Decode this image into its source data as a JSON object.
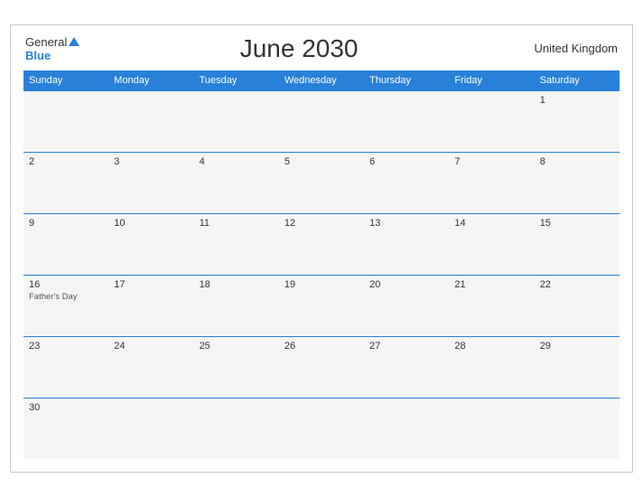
{
  "header": {
    "logo_general": "General",
    "logo_blue": "Blue",
    "title": "June 2030",
    "region": "United Kingdom"
  },
  "weekdays": [
    "Sunday",
    "Monday",
    "Tuesday",
    "Wednesday",
    "Thursday",
    "Friday",
    "Saturday"
  ],
  "weeks": [
    [
      {
        "day": "",
        "event": ""
      },
      {
        "day": "",
        "event": ""
      },
      {
        "day": "",
        "event": ""
      },
      {
        "day": "",
        "event": ""
      },
      {
        "day": "",
        "event": ""
      },
      {
        "day": "",
        "event": ""
      },
      {
        "day": "1",
        "event": ""
      }
    ],
    [
      {
        "day": "2",
        "event": ""
      },
      {
        "day": "3",
        "event": ""
      },
      {
        "day": "4",
        "event": ""
      },
      {
        "day": "5",
        "event": ""
      },
      {
        "day": "6",
        "event": ""
      },
      {
        "day": "7",
        "event": ""
      },
      {
        "day": "8",
        "event": ""
      }
    ],
    [
      {
        "day": "9",
        "event": ""
      },
      {
        "day": "10",
        "event": ""
      },
      {
        "day": "11",
        "event": ""
      },
      {
        "day": "12",
        "event": ""
      },
      {
        "day": "13",
        "event": ""
      },
      {
        "day": "14",
        "event": ""
      },
      {
        "day": "15",
        "event": ""
      }
    ],
    [
      {
        "day": "16",
        "event": "Father's Day"
      },
      {
        "day": "17",
        "event": ""
      },
      {
        "day": "18",
        "event": ""
      },
      {
        "day": "19",
        "event": ""
      },
      {
        "day": "20",
        "event": ""
      },
      {
        "day": "21",
        "event": ""
      },
      {
        "day": "22",
        "event": ""
      }
    ],
    [
      {
        "day": "23",
        "event": ""
      },
      {
        "day": "24",
        "event": ""
      },
      {
        "day": "25",
        "event": ""
      },
      {
        "day": "26",
        "event": ""
      },
      {
        "day": "27",
        "event": ""
      },
      {
        "day": "28",
        "event": ""
      },
      {
        "day": "29",
        "event": ""
      }
    ],
    [
      {
        "day": "30",
        "event": ""
      },
      {
        "day": "",
        "event": ""
      },
      {
        "day": "",
        "event": ""
      },
      {
        "day": "",
        "event": ""
      },
      {
        "day": "",
        "event": ""
      },
      {
        "day": "",
        "event": ""
      },
      {
        "day": "",
        "event": ""
      }
    ]
  ]
}
